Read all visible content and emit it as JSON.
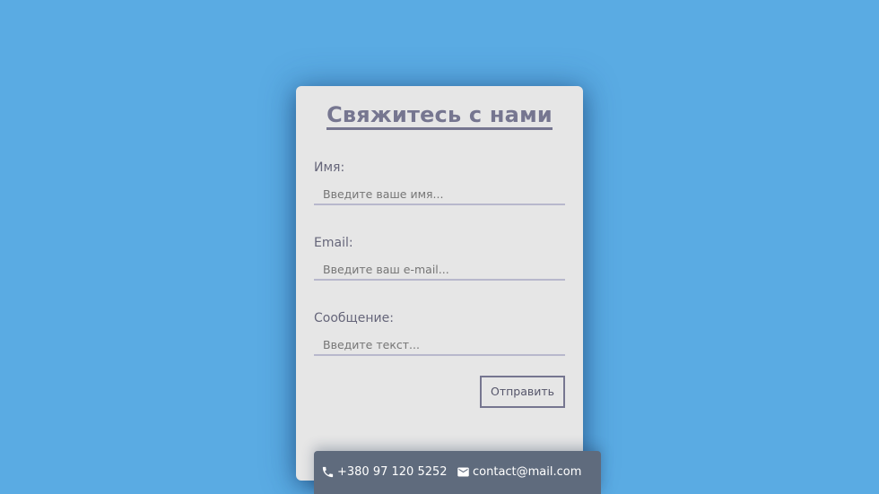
{
  "form": {
    "title": "Свяжитесь с нами",
    "fields": [
      {
        "label": "Имя:",
        "placeholder": "Введите ваше имя..."
      },
      {
        "label": "Email:",
        "placeholder": "Введите ваш e-mail..."
      },
      {
        "label": "Сообщение:",
        "placeholder": "Введите текст..."
      }
    ],
    "submit_label": "Отправить"
  },
  "contacts": {
    "phone": {
      "icon": "phone-icon",
      "text": "+380 97 120 5252"
    },
    "email": {
      "icon": "mail-icon",
      "text": "contact@mail.com"
    }
  },
  "colors": {
    "background": "#5aabe3",
    "card": "#e6e6e6",
    "accent": "#767690",
    "contact_bar": "#5f6b7d"
  }
}
